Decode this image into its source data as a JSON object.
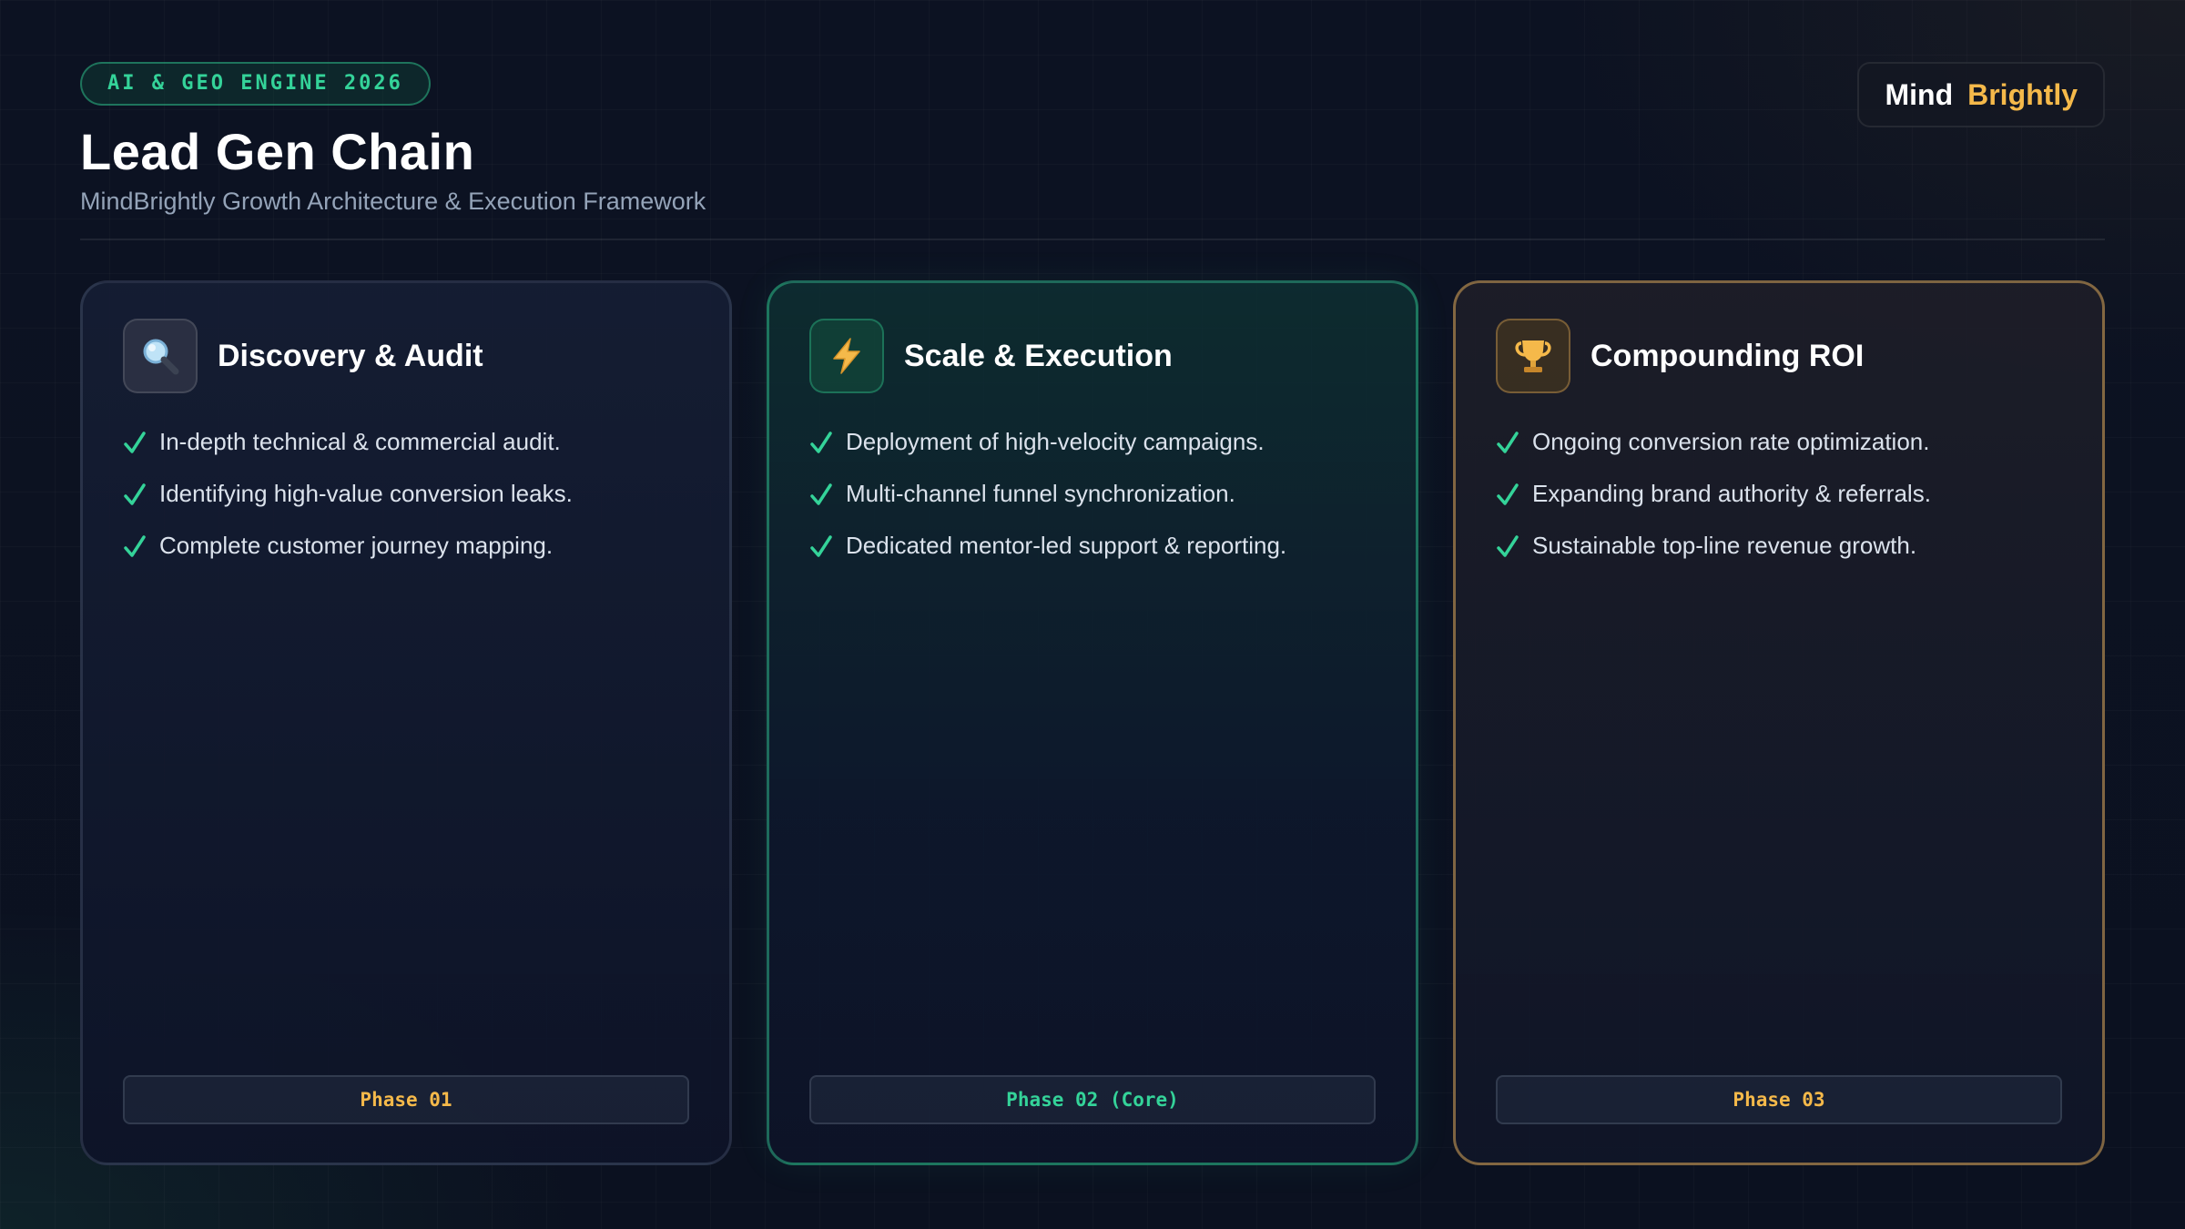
{
  "header": {
    "badge": "AI & GEO ENGINE 2026",
    "title": "Lead Gen Chain",
    "subtitle": "MindBrightly Growth Architecture & Execution Framework"
  },
  "brand": {
    "part1": "Mind",
    "part2": "Brightly"
  },
  "colors": {
    "accent_green": "#34d399",
    "accent_gold": "#f5b94a",
    "background": "#0b1120"
  },
  "cards": [
    {
      "icon": "magnifying-glass-icon",
      "title": "Discovery & Audit",
      "items": [
        "In-depth technical & commercial audit.",
        "Identifying high-value conversion leaks.",
        "Complete customer journey mapping."
      ],
      "phase": "Phase 01"
    },
    {
      "icon": "lightning-bolt-icon",
      "title": "Scale & Execution",
      "items": [
        "Deployment of high-velocity campaigns.",
        "Multi-channel funnel synchronization.",
        "Dedicated mentor-led support & reporting."
      ],
      "phase": "Phase 02 (Core)"
    },
    {
      "icon": "trophy-icon",
      "title": "Compounding ROI",
      "items": [
        "Ongoing conversion rate optimization.",
        "Expanding brand authority & referrals.",
        "Sustainable top-line revenue growth."
      ],
      "phase": "Phase 03"
    }
  ]
}
